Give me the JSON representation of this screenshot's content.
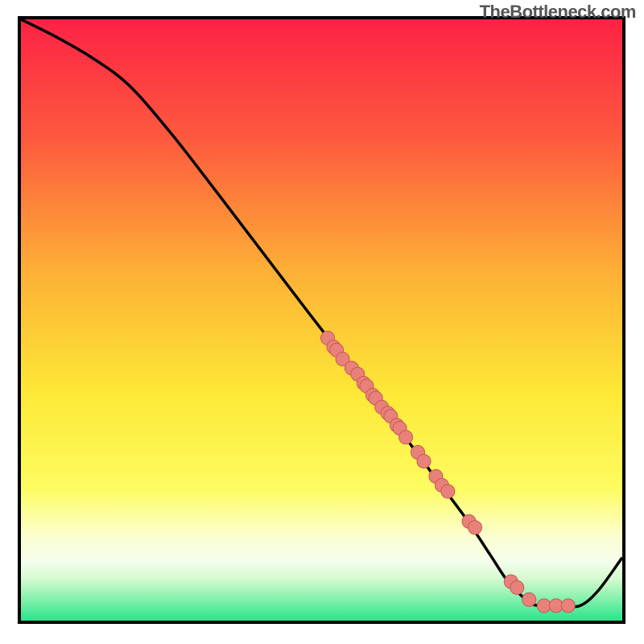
{
  "watermark": "TheBottleneck.com",
  "colors": {
    "gradient_top": "#fd2245",
    "gradient_mid_upper": "#fd8c3a",
    "gradient_mid": "#fde036",
    "gradient_mid_lower": "#fffea0",
    "gradient_band_pale": "#eafdd4",
    "gradient_bottom": "#28e58a",
    "curve": "#000000",
    "dot_fill": "#e9817b",
    "dot_stroke": "#c65a54"
  },
  "chart_data": {
    "type": "line",
    "title": "",
    "xlabel": "",
    "ylabel": "",
    "xlim": [
      0,
      100
    ],
    "ylim": [
      0,
      100
    ],
    "series": [
      {
        "name": "curve",
        "x": [
          0,
          6,
          12,
          18,
          25,
          32,
          40,
          48,
          55,
          62,
          68,
          74,
          78,
          81,
          84,
          86,
          90,
          93,
          96,
          100
        ],
        "y": [
          100,
          97,
          93.5,
          89,
          81,
          72,
          61.5,
          51,
          42,
          33,
          25,
          17,
          11,
          6.5,
          3.5,
          2.5,
          2.5,
          2.5,
          5,
          10.5
        ]
      }
    ],
    "points": {
      "name": "markers",
      "x": [
        51,
        52,
        52.5,
        53.5,
        55,
        56,
        57,
        57.5,
        58.5,
        59,
        60,
        61,
        61.5,
        62.5,
        63,
        64,
        66,
        67,
        69,
        70,
        71,
        74.5,
        75.5,
        81.5,
        82.5,
        84.5,
        87,
        89,
        91
      ],
      "y": [
        47,
        45.5,
        45,
        43.5,
        42,
        41,
        39.5,
        39,
        37.5,
        37,
        35.5,
        34.5,
        34,
        32.5,
        32,
        30.5,
        28,
        26.5,
        24,
        22.5,
        21.5,
        16.5,
        15.5,
        6.5,
        5.5,
        3.5,
        2.5,
        2.5,
        2.5
      ]
    }
  }
}
